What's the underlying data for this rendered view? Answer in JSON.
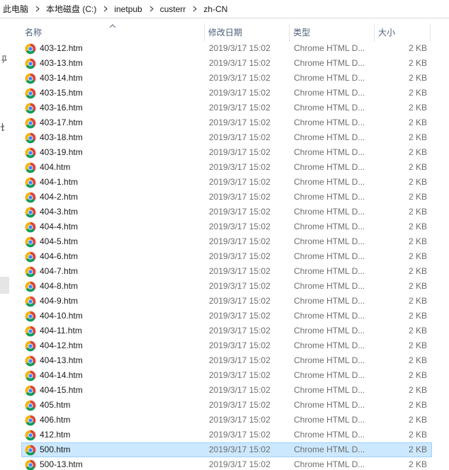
{
  "breadcrumb": [
    "此电脑",
    "本地磁盘 (C:)",
    "inetpub",
    "custerr",
    "zh-CN"
  ],
  "nav": {
    "fragment_char": "长"
  },
  "columns": {
    "name": "名称",
    "date": "修改日期",
    "type": "类型",
    "size": "大小"
  },
  "files": [
    {
      "name": "403-12.htm",
      "date": "2019/3/17 15:02",
      "type": "Chrome HTML D...",
      "size": "2 KB"
    },
    {
      "name": "403-13.htm",
      "date": "2019/3/17 15:02",
      "type": "Chrome HTML D...",
      "size": "2 KB"
    },
    {
      "name": "403-14.htm",
      "date": "2019/3/17 15:02",
      "type": "Chrome HTML D...",
      "size": "2 KB"
    },
    {
      "name": "403-15.htm",
      "date": "2019/3/17 15:02",
      "type": "Chrome HTML D...",
      "size": "2 KB"
    },
    {
      "name": "403-16.htm",
      "date": "2019/3/17 15:02",
      "type": "Chrome HTML D...",
      "size": "2 KB"
    },
    {
      "name": "403-17.htm",
      "date": "2019/3/17 15:02",
      "type": "Chrome HTML D...",
      "size": "2 KB"
    },
    {
      "name": "403-18.htm",
      "date": "2019/3/17 15:02",
      "type": "Chrome HTML D...",
      "size": "2 KB"
    },
    {
      "name": "403-19.htm",
      "date": "2019/3/17 15:02",
      "type": "Chrome HTML D...",
      "size": "2 KB"
    },
    {
      "name": "404.htm",
      "date": "2019/3/17 15:02",
      "type": "Chrome HTML D...",
      "size": "2 KB"
    },
    {
      "name": "404-1.htm",
      "date": "2019/3/17 15:02",
      "type": "Chrome HTML D...",
      "size": "2 KB"
    },
    {
      "name": "404-2.htm",
      "date": "2019/3/17 15:02",
      "type": "Chrome HTML D...",
      "size": "2 KB"
    },
    {
      "name": "404-3.htm",
      "date": "2019/3/17 15:02",
      "type": "Chrome HTML D...",
      "size": "2 KB"
    },
    {
      "name": "404-4.htm",
      "date": "2019/3/17 15:02",
      "type": "Chrome HTML D...",
      "size": "2 KB"
    },
    {
      "name": "404-5.htm",
      "date": "2019/3/17 15:02",
      "type": "Chrome HTML D...",
      "size": "2 KB"
    },
    {
      "name": "404-6.htm",
      "date": "2019/3/17 15:02",
      "type": "Chrome HTML D...",
      "size": "2 KB"
    },
    {
      "name": "404-7.htm",
      "date": "2019/3/17 15:02",
      "type": "Chrome HTML D...",
      "size": "2 KB"
    },
    {
      "name": "404-8.htm",
      "date": "2019/3/17 15:02",
      "type": "Chrome HTML D...",
      "size": "2 KB"
    },
    {
      "name": "404-9.htm",
      "date": "2019/3/17 15:02",
      "type": "Chrome HTML D...",
      "size": "2 KB"
    },
    {
      "name": "404-10.htm",
      "date": "2019/3/17 15:02",
      "type": "Chrome HTML D...",
      "size": "2 KB"
    },
    {
      "name": "404-11.htm",
      "date": "2019/3/17 15:02",
      "type": "Chrome HTML D...",
      "size": "2 KB"
    },
    {
      "name": "404-12.htm",
      "date": "2019/3/17 15:02",
      "type": "Chrome HTML D...",
      "size": "2 KB"
    },
    {
      "name": "404-13.htm",
      "date": "2019/3/17 15:02",
      "type": "Chrome HTML D...",
      "size": "2 KB"
    },
    {
      "name": "404-14.htm",
      "date": "2019/3/17 15:02",
      "type": "Chrome HTML D...",
      "size": "2 KB"
    },
    {
      "name": "404-15.htm",
      "date": "2019/3/17 15:02",
      "type": "Chrome HTML D...",
      "size": "2 KB"
    },
    {
      "name": "405.htm",
      "date": "2019/3/17 15:02",
      "type": "Chrome HTML D...",
      "size": "2 KB"
    },
    {
      "name": "406.htm",
      "date": "2019/3/17 15:02",
      "type": "Chrome HTML D...",
      "size": "2 KB"
    },
    {
      "name": "412.htm",
      "date": "2019/3/17 15:02",
      "type": "Chrome HTML D...",
      "size": "2 KB"
    },
    {
      "name": "500.htm",
      "date": "2019/3/17 15:02",
      "type": "Chrome HTML D...",
      "size": "2 KB",
      "selected": true
    },
    {
      "name": "500-13.htm",
      "date": "2019/3/17 15:02",
      "type": "Chrome HTML D...",
      "size": "2 KB"
    }
  ],
  "icons": {
    "file": "chrome-html-file-icon",
    "sort": "sort-ascending-icon",
    "separator": "chevron-right-icon",
    "pin": "pin-icon"
  },
  "colors": {
    "selection_bg": "#cce8ff",
    "selection_border": "#99d1ff",
    "header_text": "#4c607a"
  }
}
